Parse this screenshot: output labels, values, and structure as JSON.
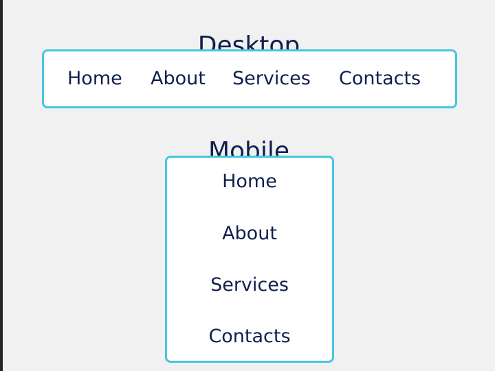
{
  "desktop": {
    "title": "Desktop",
    "items": [
      {
        "label": "Home"
      },
      {
        "label": "About"
      },
      {
        "label": "Services"
      },
      {
        "label": "Contacts"
      }
    ]
  },
  "mobile": {
    "title": "Mobile",
    "items": [
      {
        "label": "Home"
      },
      {
        "label": "About"
      },
      {
        "label": "Services"
      },
      {
        "label": "Contacts"
      }
    ]
  },
  "colors": {
    "background": "#f1f1f1",
    "nav_background": "#ffffff",
    "border_accent": "#45c6e0",
    "text": "#0f1f4d",
    "left_edge": "#262626"
  }
}
